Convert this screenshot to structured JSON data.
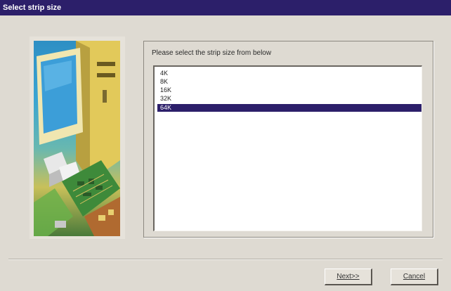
{
  "window": {
    "title": "Select strip size"
  },
  "wizard": {
    "prompt": "Please select the strip size from below",
    "strip_sizes": [
      "4K",
      "8K",
      "16K",
      "32K",
      "64K"
    ],
    "selected_index": 4
  },
  "buttons": {
    "next": "Next>>",
    "cancel": "Cancel"
  },
  "colors": {
    "titlebar": "#2c1f6a",
    "selection": "#2c1f6a",
    "dialog_bg": "#dedad2"
  },
  "illustration": {
    "subject": "computer-with-circuit-board-illustration"
  }
}
